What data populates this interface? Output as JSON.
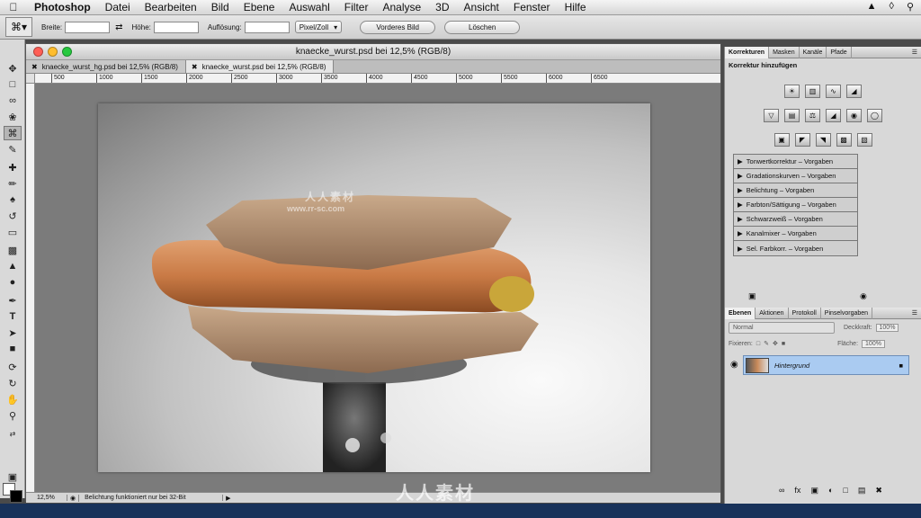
{
  "menubar": {
    "app": "Photoshop",
    "items": [
      "Datei",
      "Bearbeiten",
      "Bild",
      "Ebene",
      "Auswahl",
      "Filter",
      "Analyse",
      "3D",
      "Ansicht",
      "Fenster",
      "Hilfe"
    ]
  },
  "options": {
    "breite_label": "Breite:",
    "hoehe_label": "Höhe:",
    "aufloesung_label": "Auflösung:",
    "unit_select": "Pixel/Zoll",
    "vorderes_bild": "Vorderes Bild",
    "loeschen": "Löschen"
  },
  "document": {
    "title": "knaecke_wurst.psd bei 12,5% (RGB/8)",
    "tabs": [
      "knaecke_wurst_hg.psd bei 12,5% (RGB/8)",
      "knaecke_wurst.psd bei 12,5% (RGB/8)"
    ],
    "ruler_ticks": [
      "500",
      "1000",
      "1500",
      "2000",
      "2500",
      "3000",
      "3500",
      "4000",
      "4500",
      "5000",
      "5500",
      "6000",
      "6500"
    ],
    "zoom": "12,5%",
    "status_info": "Belichtung funktioniert nur bei 32-Bit"
  },
  "korrekturen": {
    "tabs": [
      "Korrekturen",
      "Masken",
      "Kanäle",
      "Pfade"
    ],
    "heading": "Korrektur hinzufügen",
    "presets": [
      "Tonwertkorrektur – Vorgaben",
      "Gradationskurven – Vorgaben",
      "Belichtung – Vorgaben",
      "Farbton/Sättigung – Vorgaben",
      "Schwarzweiß – Vorgaben",
      "Kanalmixer – Vorgaben",
      "Sel. Farbkorr. – Vorgaben"
    ]
  },
  "ebenen": {
    "tabs": [
      "Ebenen",
      "Aktionen",
      "Protokoll",
      "Pinselvorgaben"
    ],
    "blend_mode": "Normal",
    "deckkraft_label": "Deckkraft:",
    "deckkraft_value": "100%",
    "fixieren_label": "Fixieren:",
    "flaeche_label": "Fläche:",
    "flaeche_value": "100%",
    "layer_name": "Hintergrund"
  },
  "watermark": {
    "text": "人人素材",
    "url": "www.rr-sc.com"
  }
}
